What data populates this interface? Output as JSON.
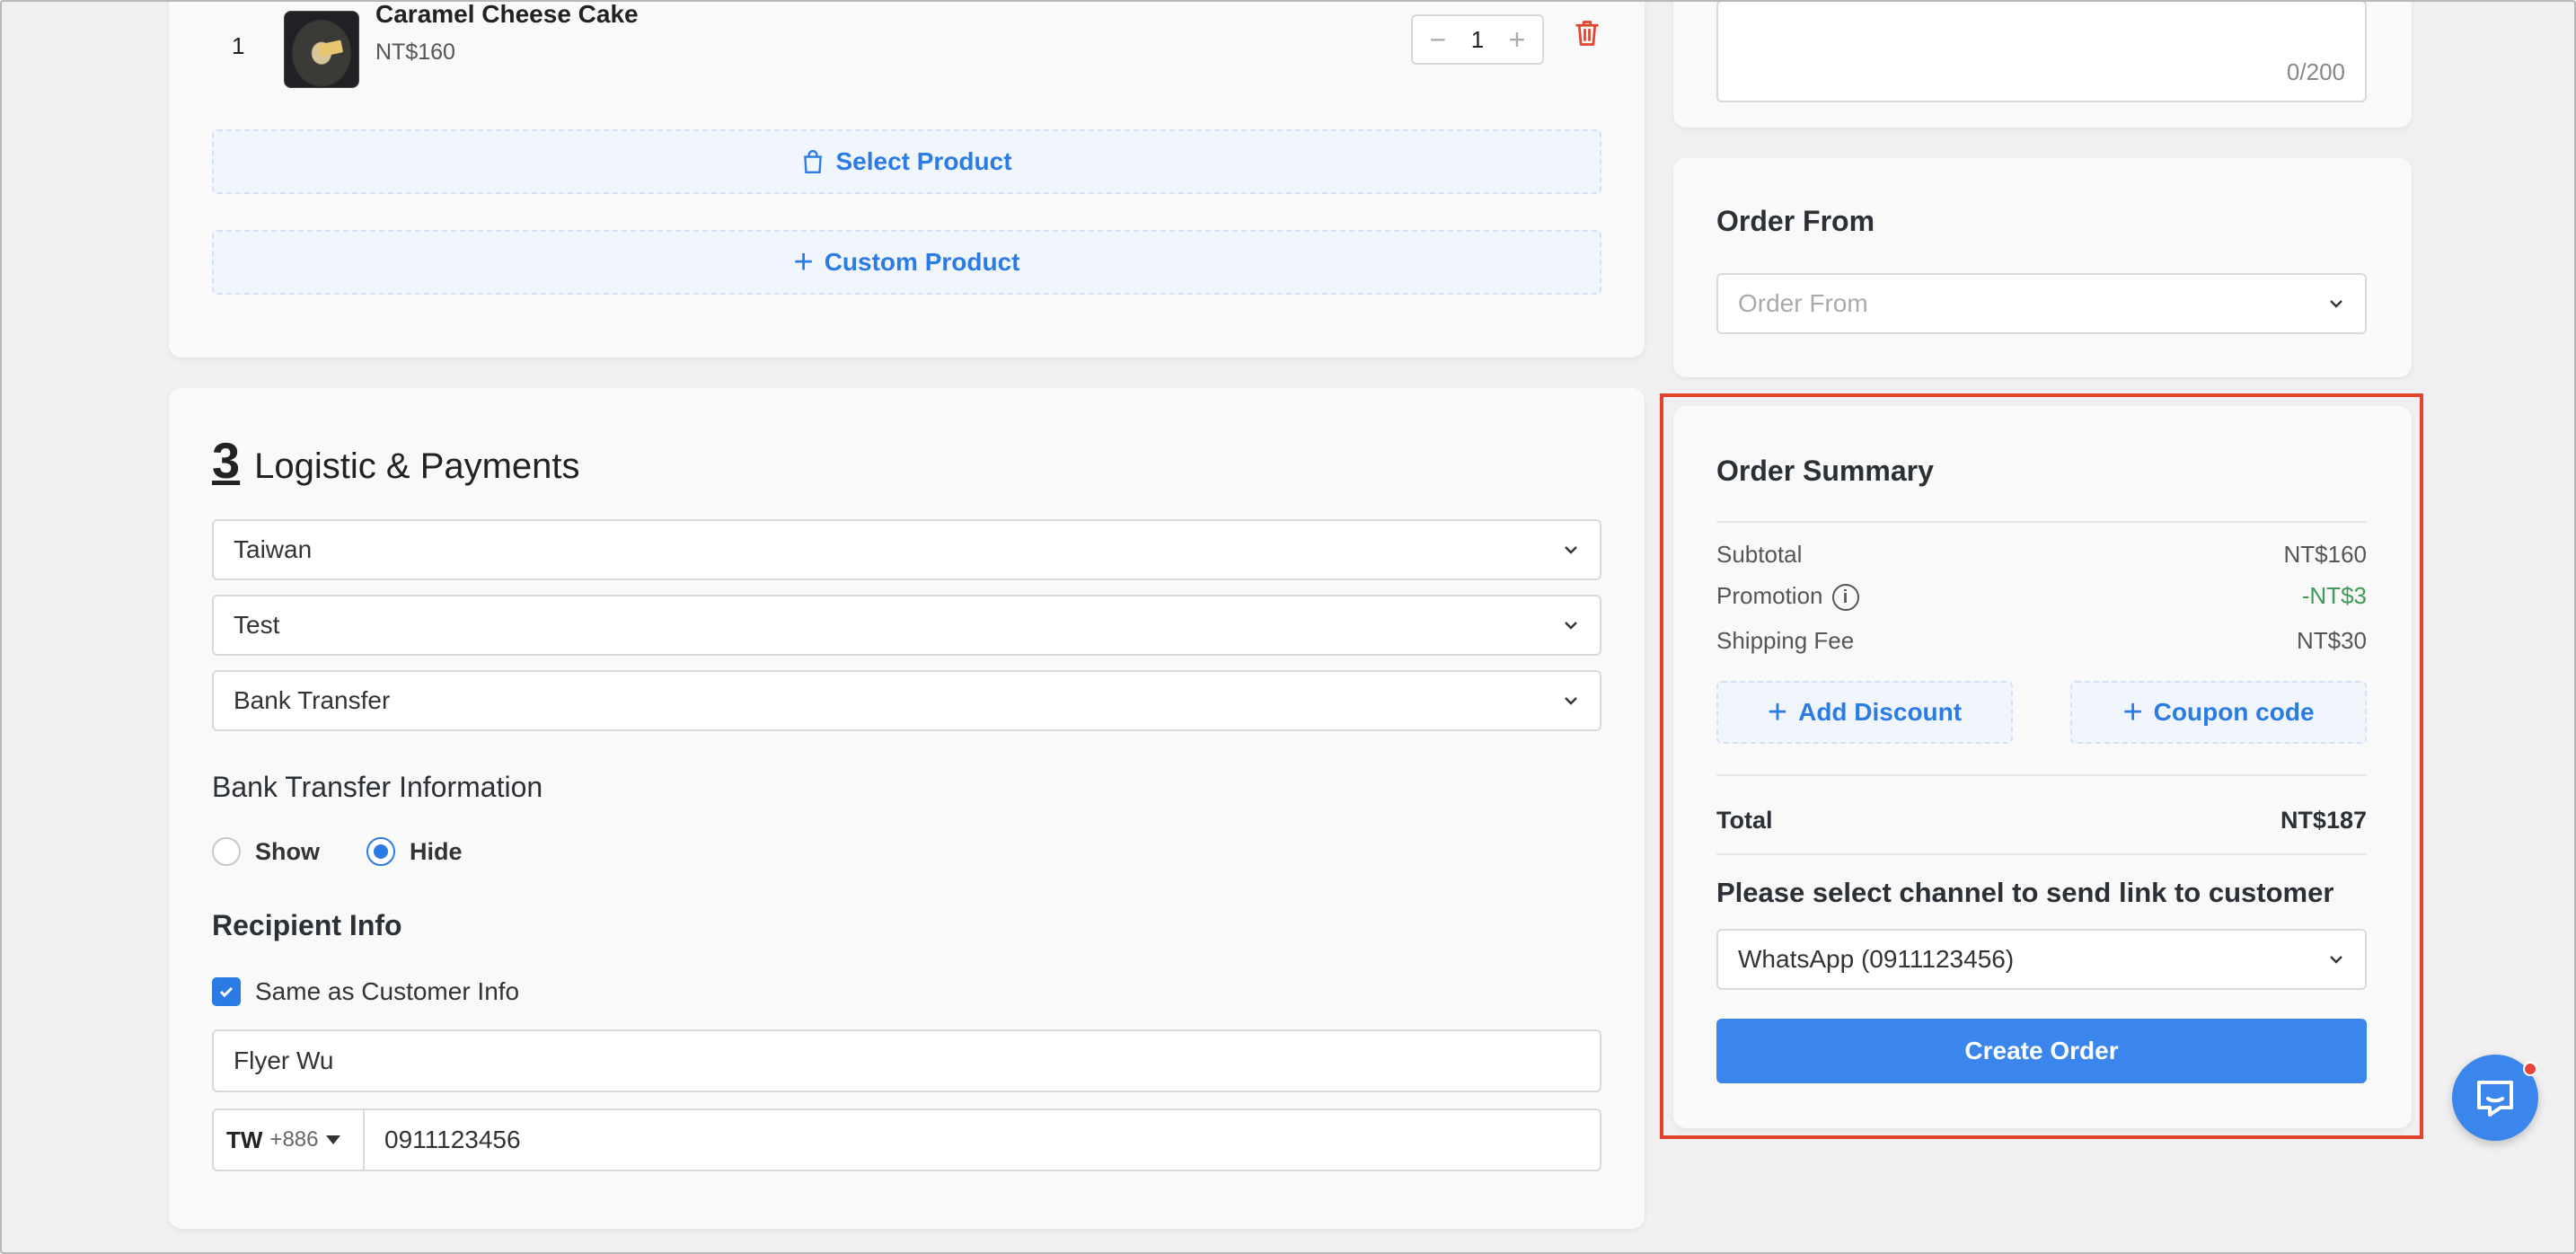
{
  "products": {
    "items": [
      {
        "index": "1",
        "name": "Caramel Cheese Cake",
        "price": "NT$160",
        "quantity": "1"
      }
    ],
    "select_product_label": "Select Product",
    "custom_product_label": "Custom Product"
  },
  "note": {
    "counter": "0/200"
  },
  "order_from": {
    "title": "Order From",
    "placeholder": "Order From"
  },
  "logistics": {
    "section_number": "3",
    "section_title": "Logistic & Payments",
    "country": "Taiwan",
    "shipping_method": "Test",
    "payment_method": "Bank Transfer",
    "bank_info_title": "Bank Transfer Information",
    "bank_info_options": [
      {
        "label": "Show",
        "selected": false
      },
      {
        "label": "Hide",
        "selected": true
      }
    ],
    "recipient_title": "Recipient Info",
    "same_as_customer_label": "Same as Customer Info",
    "same_as_customer_checked": true,
    "recipient_name": "Flyer Wu",
    "phone_country": "TW",
    "phone_dial_code": "+886",
    "phone_number": "0911123456"
  },
  "summary": {
    "title": "Order Summary",
    "subtotal_label": "Subtotal",
    "subtotal_value": "NT$160",
    "promotion_label": "Promotion",
    "promotion_value": "-NT$3",
    "shipping_label": "Shipping Fee",
    "shipping_value": "NT$30",
    "add_discount_label": "Add Discount",
    "coupon_label": "Coupon code",
    "total_label": "Total",
    "total_value": "NT$187",
    "channel_prompt": "Please select channel to send link to customer",
    "channel_value": "WhatsApp (0911123456)",
    "create_order_label": "Create Order"
  },
  "colors": {
    "accent": "#2b7be4",
    "primary_button": "#3a86ec",
    "promotion_green": "#3f9a5c",
    "delete_red": "#e2432f",
    "highlight_border": "#e2432f"
  },
  "icons": [
    "minus-icon",
    "plus-icon",
    "trash-icon",
    "shopping-bag-icon",
    "chevron-down-icon",
    "info-icon",
    "check-icon",
    "caret-down-icon",
    "chat-icon"
  ]
}
